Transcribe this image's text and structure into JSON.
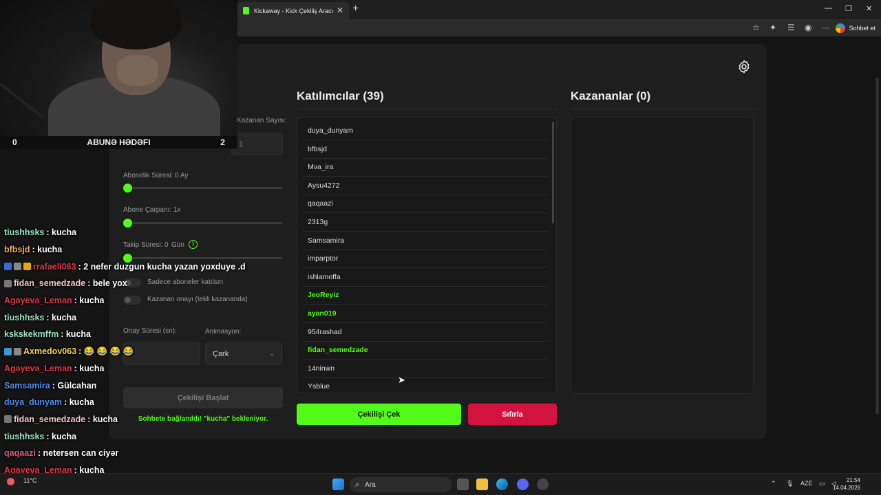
{
  "browser": {
    "tab_title": "Kickaway - Kick Çekiliş Aracı",
    "profile_label": "Sohbet et",
    "window": {
      "minimize": "—",
      "restore": "❐",
      "close": "✕"
    }
  },
  "settings_panel": {
    "winner_count_label": "Kazanan Sayısı:",
    "winner_count_value": "1",
    "sub_duration_label": "Abonelik Süresi: 0 Ay",
    "sub_multiplier_label": "Abone Çarpanı: 1x",
    "follow_duration_label": "Takip Süresi:",
    "follow_duration_value": "0",
    "follow_duration_unit": "Gün",
    "subs_only_label": "Sadece aboneler katılsın",
    "winner_confirm_label": "Kazanan onayı (tekli kazananda)",
    "confirm_time_label": "Onay Süresi (sn):",
    "animation_label": "Animasyon:",
    "animation_value": "Çark",
    "start_button": "Çekilişi Başlat",
    "status_text": "Sohbete bağlanıldı! \"kucha\" bekleniyor."
  },
  "participants": {
    "title": "Katılımcılar (39)",
    "items": [
      {
        "name": "duya_dunyam",
        "highlight": false
      },
      {
        "name": "bfbsjd",
        "highlight": false
      },
      {
        "name": "Mva_ira",
        "highlight": false
      },
      {
        "name": "Aysu4272",
        "highlight": false
      },
      {
        "name": "qaqaazi",
        "highlight": false
      },
      {
        "name": "2313g",
        "highlight": false
      },
      {
        "name": "Samsamira",
        "highlight": false
      },
      {
        "name": "imparptor",
        "highlight": false
      },
      {
        "name": "ishlamoffa",
        "highlight": false
      },
      {
        "name": "JeoReyiz",
        "highlight": true
      },
      {
        "name": "ayan019",
        "highlight": true
      },
      {
        "name": "954rashad",
        "highlight": false
      },
      {
        "name": "fidan_semedzade",
        "highlight": true
      },
      {
        "name": "14ninwn",
        "highlight": false
      },
      {
        "name": "Ysblue",
        "highlight": false
      }
    ]
  },
  "winners": {
    "title": "Kazananlar (0)"
  },
  "actions": {
    "draw": "Çekilişi Çek",
    "reset": "Sıfırla"
  },
  "stream_overlay": {
    "goal_left": "0",
    "goal_title": "ABUNƏ HƏDƏFI",
    "goal_right": "2",
    "chat": [
      {
        "user": "tiushhsks",
        "color": "#9be3c4",
        "text": ": kucha",
        "badges": []
      },
      {
        "user": "bfbsjd",
        "color": "#e8b060",
        "text": ": kucha",
        "badges": []
      },
      {
        "user": "rrafaell063",
        "color": "#e0384a",
        "text": ": 2 nefer duzgun kucha yazan yoxduye .d",
        "badges": [
          "#3b6ad6",
          "#888",
          "#e6a800"
        ]
      },
      {
        "user": "fidan_semedzade",
        "color": "#f4c6c6",
        "text": ": bele yox",
        "badges": [
          "#777"
        ]
      },
      {
        "user": "Agayeva_Leman",
        "color": "#e0384a",
        "text": ": kucha",
        "badges": []
      },
      {
        "user": "tiushhsks",
        "color": "#9be3c4",
        "text": ": kucha",
        "badges": []
      },
      {
        "user": "kskskekmffm",
        "color": "#9be3c4",
        "text": ": kucha",
        "badges": []
      },
      {
        "user": "Axmedov063",
        "color": "#f3d54e",
        "text": ": 😂 😂 😂 😂",
        "badges": [
          "#3b9ad6",
          "#888"
        ]
      },
      {
        "user": "Agayeva_Leman",
        "color": "#e0384a",
        "text": ": kucha",
        "badges": []
      },
      {
        "user": "Samsamira",
        "color": "#4c8ef0",
        "text": ": Gülcahan",
        "badges": []
      },
      {
        "user": "duya_dunyam",
        "color": "#4c8ef0",
        "text": ": kucha",
        "badges": []
      },
      {
        "user": "fidan_semedzade",
        "color": "#f4c6c6",
        "text": ": kucha",
        "badges": [
          "#777"
        ]
      },
      {
        "user": "tiushhsks",
        "color": "#9be3c4",
        "text": ": kucha",
        "badges": []
      },
      {
        "user": "qaqaazi",
        "color": "#e05a78",
        "text": ": netersen can ciyər",
        "badges": []
      },
      {
        "user": "Agayeva_Leman",
        "color": "#e0384a",
        "text": ": kucha",
        "badges": []
      },
      {
        "user": "tiushhsks",
        "color": "#9be3c4",
        "text": ": kucha",
        "badges": []
      }
    ]
  },
  "taskbar": {
    "weather": "11°C",
    "search_placeholder": "Ara",
    "language": "AZE",
    "time": "21:54",
    "date": "14.04.2026"
  },
  "colors": {
    "accent_green": "#53fc18",
    "danger_red": "#d4123e",
    "panel_bg": "#1e1e1e"
  }
}
